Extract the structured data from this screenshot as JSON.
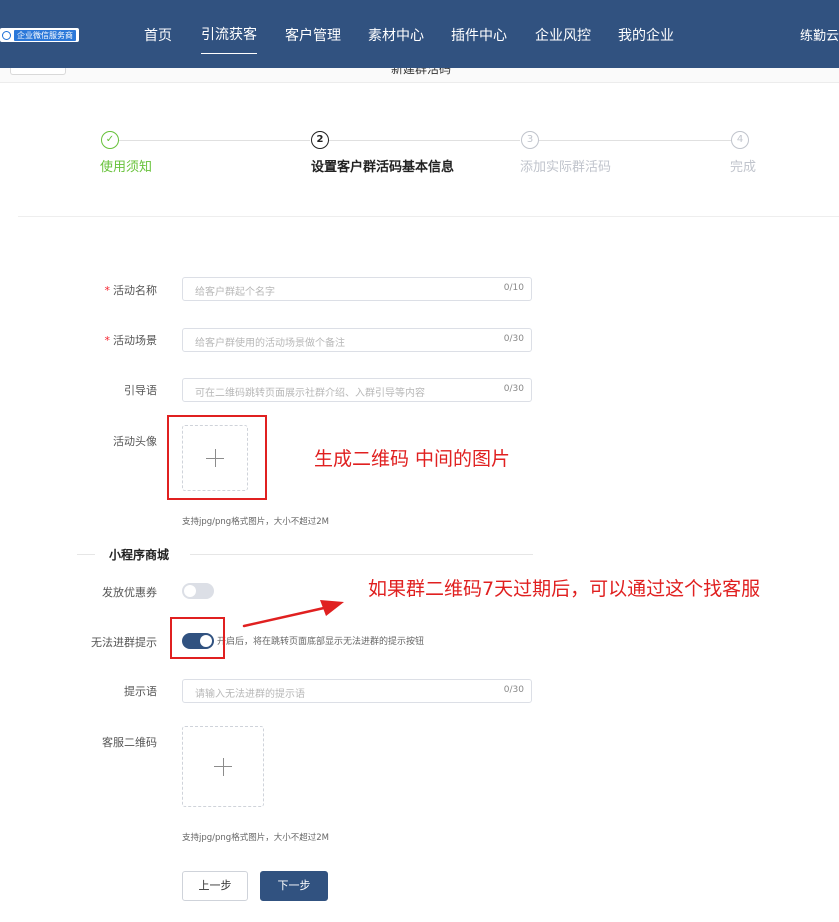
{
  "app": {
    "logo_text": "企业微信服务商",
    "user_name": "练勤云"
  },
  "nav": {
    "items": [
      "首页",
      "引流获客",
      "客户管理",
      "素材中心",
      "插件中心",
      "企业风控",
      "我的企业"
    ],
    "active_index": 1
  },
  "subheader": {
    "title": "新建群活码"
  },
  "steps": [
    {
      "number": "✓",
      "label": "使用须知",
      "state": "done"
    },
    {
      "number": "2",
      "label": "设置客户群活码基本信息",
      "state": "active"
    },
    {
      "number": "3",
      "label": "添加实际群活码",
      "state": "pending"
    },
    {
      "number": "4",
      "label": "完成",
      "state": "pending"
    }
  ],
  "form": {
    "activity_name": {
      "label": "活动名称",
      "required": true,
      "placeholder": "给客户群起个名字",
      "count": "0/10"
    },
    "activity_scene": {
      "label": "活动场景",
      "required": true,
      "placeholder": "给客户群使用的活动场景做个备注",
      "count": "0/30"
    },
    "guide_text": {
      "label": "引导语",
      "required": false,
      "placeholder": "可在二维码跳转页面展示社群介绍、入群引导等内容",
      "count": "0/30"
    },
    "activity_avatar": {
      "label": "活动头像",
      "hint": "支持jpg/png格式图片，大小不超过2M"
    },
    "section_title": "小程序商城",
    "coupon": {
      "label": "发放优惠券",
      "enabled": false
    },
    "cannot_join": {
      "label": "无法进群提示",
      "enabled": true,
      "note": "开启后，将在跳转页面底部显示无法进群的提示按钮"
    },
    "prompt_text": {
      "label": "提示语",
      "placeholder": "请输入无法进群的提示语",
      "count": "0/30"
    },
    "service_qr": {
      "label": "客服二维码",
      "hint": "支持jpg/png格式图片，大小不超过2M"
    },
    "buttons": {
      "prev": "上一步",
      "next": "下一步"
    }
  },
  "annotations": {
    "avatar_note": "生成二维码 中间的图片",
    "switch_note": "如果群二维码7天过期后，可以通过这个找客服"
  },
  "colors": {
    "nav_bg": "#315280",
    "success": "#67c23a",
    "annotation": "#e02020",
    "required": "#f5222d"
  }
}
